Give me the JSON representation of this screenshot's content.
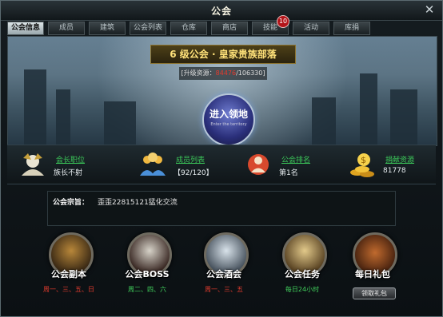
{
  "window": {
    "title": "公会"
  },
  "tabs": [
    {
      "label": "公会信息",
      "active": true
    },
    {
      "label": "成员"
    },
    {
      "label": "建筑"
    },
    {
      "label": "公会列表"
    },
    {
      "label": "仓库"
    },
    {
      "label": "商店"
    },
    {
      "label": "技能",
      "badge": "10"
    },
    {
      "label": "活动"
    },
    {
      "label": "库捐"
    }
  ],
  "guild": {
    "banner": "6 级公会 · 皇家贵族部落",
    "resource_prefix": "[升级资源：",
    "resource_current": "84476",
    "resource_suffix": "/106330]",
    "enter_cn": "进入领地",
    "enter_en": "Enter the territory"
  },
  "stats": [
    {
      "label": "会长职位",
      "value": "族长不射",
      "icon": "leader-icon"
    },
    {
      "label": "成员列表",
      "value": "【92/120】",
      "icon": "members-icon"
    },
    {
      "label": "公会排名",
      "value": "第1名",
      "icon": "rank-icon"
    },
    {
      "label": "捐献资源",
      "value": "81778",
      "icon": "gold-icon"
    }
  ],
  "motto": {
    "label": "公会宗旨：",
    "text": "歪歪22815121猛化交流"
  },
  "features": [
    {
      "label": "公会副本",
      "time": "周一、三、五、日",
      "time_color": "red",
      "icon": "dungeon-icon"
    },
    {
      "label": "公会BOSS",
      "time": "周二、四、六",
      "time_color": "green",
      "icon": "boss-icon"
    },
    {
      "label": "公会酒会",
      "time": "周一、三、五",
      "time_color": "red",
      "icon": "tavern-icon"
    },
    {
      "label": "公会任务",
      "time": "每日24小时",
      "time_color": "green",
      "icon": "quest-icon"
    },
    {
      "label": "每日礼包",
      "button": "领取礼包",
      "icon": "gift-chest-icon"
    }
  ]
}
